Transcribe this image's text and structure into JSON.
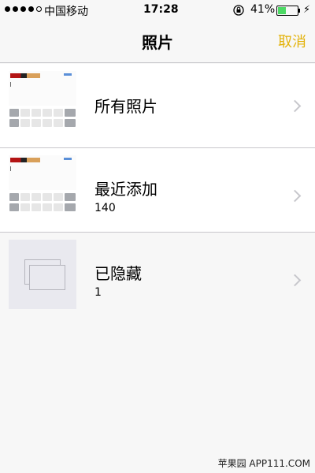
{
  "status_bar": {
    "signal_dots_filled": 4,
    "signal_dots_total": 5,
    "carrier": "中国移动",
    "time": "17:28",
    "rotation_lock_icon": "rotation-lock-icon",
    "battery_percent": "41%",
    "battery_level": 0.41,
    "battery_color": "#4cd964",
    "charging_icon": "⚡"
  },
  "nav": {
    "title": "照片",
    "cancel_label": "取消",
    "accent_color": "#e3b20a"
  },
  "albums": [
    {
      "title": "所有照片",
      "count": ""
    },
    {
      "title": "最近添加",
      "count": "140"
    },
    {
      "title": "已隐藏",
      "count": "1"
    }
  ],
  "watermark": "苹果园 APP111.COM"
}
